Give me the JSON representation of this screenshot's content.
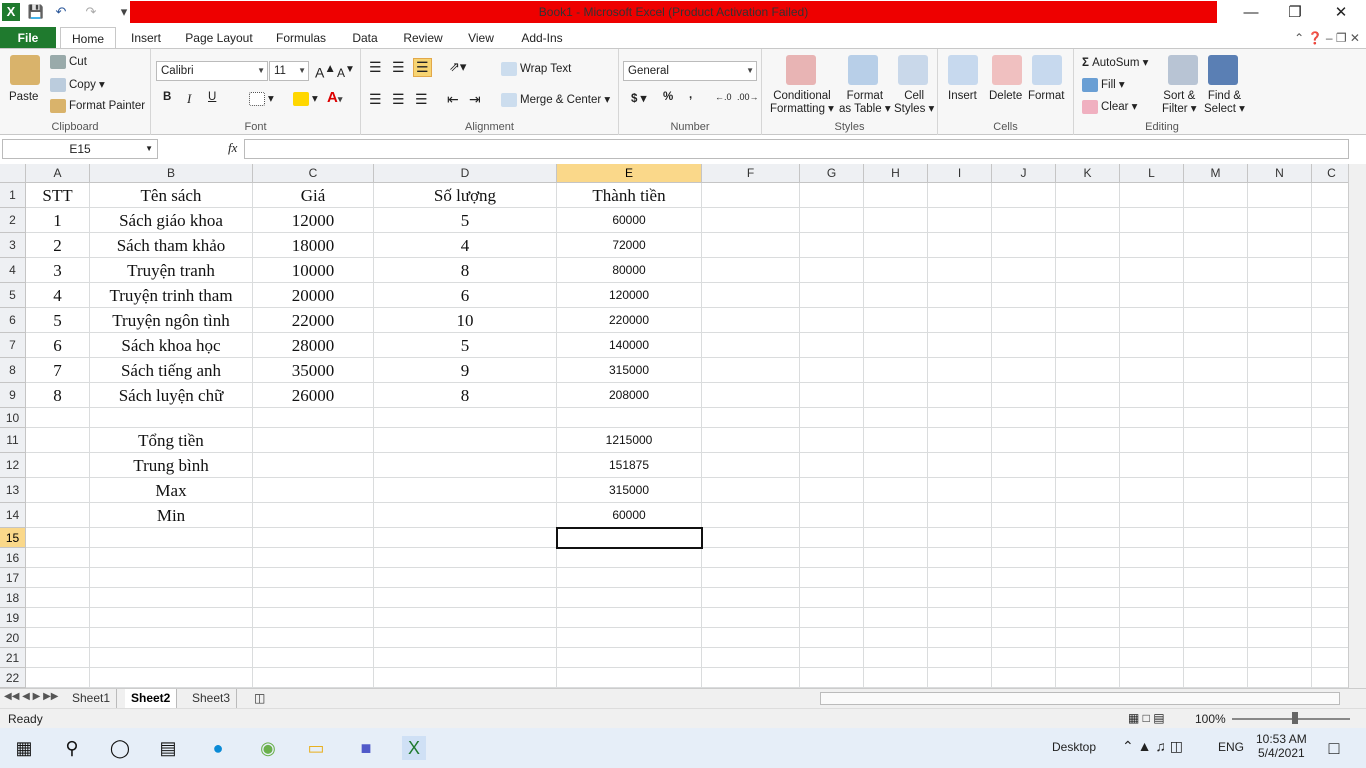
{
  "window": {
    "title": "Book1 - Microsoft Excel (Product Activation Failed)"
  },
  "tabs": [
    "File",
    "Home",
    "Insert",
    "Page Layout",
    "Formulas",
    "Data",
    "Review",
    "View",
    "Add-Ins"
  ],
  "ribbon": {
    "clipboard": {
      "label": "Clipboard",
      "paste": "Paste",
      "cut": "Cut",
      "copy": "Copy",
      "format_painter": "Format Painter"
    },
    "font": {
      "label": "Font",
      "name": "Calibri",
      "size": "11",
      "bold": "B",
      "italic": "I",
      "underline": "U"
    },
    "alignment": {
      "label": "Alignment",
      "wrap": "Wrap Text",
      "merge": "Merge & Center"
    },
    "number": {
      "label": "Number",
      "format": "General",
      "currency": "$",
      "percent": "%",
      "comma": ","
    },
    "styles": {
      "label": "Styles",
      "conditional_1": "Conditional",
      "conditional_2": "Formatting",
      "format_table_1": "Format",
      "format_table_2": "as Table",
      "cell_styles_1": "Cell",
      "cell_styles_2": "Styles"
    },
    "cells": {
      "label": "Cells",
      "insert": "Insert",
      "delete": "Delete",
      "format": "Format"
    },
    "editing": {
      "label": "Editing",
      "autosum": "AutoSum",
      "fill": "Fill",
      "clear": "Clear",
      "sort_1": "Sort &",
      "sort_2": "Filter",
      "find_1": "Find &",
      "find_2": "Select"
    }
  },
  "formula_bar": {
    "name_box": "E15",
    "fx": "fx",
    "value": ""
  },
  "columns": [
    "A",
    "B",
    "C",
    "D",
    "E",
    "F",
    "G",
    "H",
    "I",
    "J",
    "K",
    "L",
    "M",
    "N",
    "C"
  ],
  "rows": [
    "1",
    "2",
    "3",
    "4",
    "5",
    "6",
    "7",
    "8",
    "9",
    "10",
    "11",
    "12",
    "13",
    "14",
    "15",
    "16",
    "17",
    "18",
    "19",
    "20",
    "21",
    "22"
  ],
  "sheet": {
    "header": [
      "STT",
      "Tên sách",
      "Giá",
      "Số lượng",
      "Thành tiền"
    ],
    "data": [
      [
        "1",
        "Sách giáo khoa",
        "12000",
        "5",
        "60000"
      ],
      [
        "2",
        "Sách tham khảo",
        "18000",
        "4",
        "72000"
      ],
      [
        "3",
        "Truyện tranh",
        "10000",
        "8",
        "80000"
      ],
      [
        "4",
        "Truyện trinh tham",
        "20000",
        "6",
        "120000"
      ],
      [
        "5",
        "Truyện ngôn tình",
        "22000",
        "10",
        "220000"
      ],
      [
        "6",
        "Sách khoa học",
        "28000",
        "5",
        "140000"
      ],
      [
        "7",
        "Sách tiếng anh",
        "35000",
        "9",
        "315000"
      ],
      [
        "8",
        "Sách luyện chữ",
        "26000",
        "8",
        "208000"
      ]
    ],
    "summary": [
      [
        "Tổng tiền",
        "1215000"
      ],
      [
        "Trung bình",
        "151875"
      ],
      [
        "Max",
        "315000"
      ],
      [
        "Min",
        "60000"
      ]
    ]
  },
  "sheet_tabs": [
    "Sheet1",
    "Sheet2",
    "Sheet3"
  ],
  "status": {
    "ready": "Ready",
    "zoom": "100%"
  },
  "taskbar": {
    "desktop": "Desktop",
    "lang": "ENG",
    "time": "10:53 AM",
    "date": "5/4/2021"
  }
}
